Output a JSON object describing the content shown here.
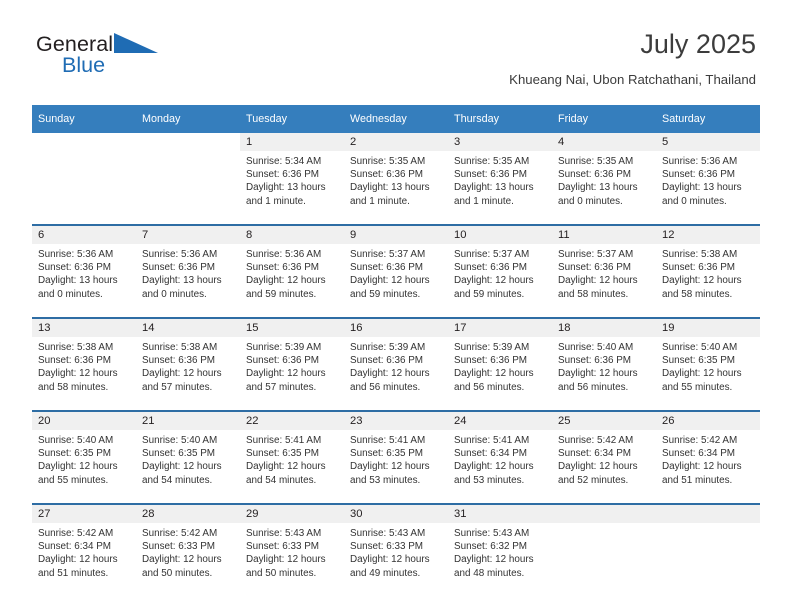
{
  "logo": {
    "line1": "General",
    "line2": "Blue",
    "triangle_color": "#1f6cb4",
    "text_color": "#231f20"
  },
  "header": {
    "title": "July 2025",
    "subtitle": "Khueang Nai, Ubon Ratchathani, Thailand"
  },
  "colors": {
    "header_row_bg": "#357ebd",
    "header_row_text": "#ffffff",
    "row_border": "#2e6da4",
    "daynum_bg": "#f0f0f0",
    "cell_text": "#333333"
  },
  "calendar": {
    "weekday_headers": [
      "Sunday",
      "Monday",
      "Tuesday",
      "Wednesday",
      "Thursday",
      "Friday",
      "Saturday"
    ],
    "weeks": [
      [
        {
          "day": "",
          "blank": true,
          "sunrise": "",
          "sunset": "",
          "daylight1": "",
          "daylight2": ""
        },
        {
          "day": "",
          "blank": true,
          "sunrise": "",
          "sunset": "",
          "daylight1": "",
          "daylight2": ""
        },
        {
          "day": "1",
          "sunrise": "Sunrise: 5:34 AM",
          "sunset": "Sunset: 6:36 PM",
          "daylight1": "Daylight: 13 hours",
          "daylight2": "and 1 minute."
        },
        {
          "day": "2",
          "sunrise": "Sunrise: 5:35 AM",
          "sunset": "Sunset: 6:36 PM",
          "daylight1": "Daylight: 13 hours",
          "daylight2": "and 1 minute."
        },
        {
          "day": "3",
          "sunrise": "Sunrise: 5:35 AM",
          "sunset": "Sunset: 6:36 PM",
          "daylight1": "Daylight: 13 hours",
          "daylight2": "and 1 minute."
        },
        {
          "day": "4",
          "sunrise": "Sunrise: 5:35 AM",
          "sunset": "Sunset: 6:36 PM",
          "daylight1": "Daylight: 13 hours",
          "daylight2": "and 0 minutes."
        },
        {
          "day": "5",
          "sunrise": "Sunrise: 5:36 AM",
          "sunset": "Sunset: 6:36 PM",
          "daylight1": "Daylight: 13 hours",
          "daylight2": "and 0 minutes."
        }
      ],
      [
        {
          "day": "6",
          "sunrise": "Sunrise: 5:36 AM",
          "sunset": "Sunset: 6:36 PM",
          "daylight1": "Daylight: 13 hours",
          "daylight2": "and 0 minutes."
        },
        {
          "day": "7",
          "sunrise": "Sunrise: 5:36 AM",
          "sunset": "Sunset: 6:36 PM",
          "daylight1": "Daylight: 13 hours",
          "daylight2": "and 0 minutes."
        },
        {
          "day": "8",
          "sunrise": "Sunrise: 5:36 AM",
          "sunset": "Sunset: 6:36 PM",
          "daylight1": "Daylight: 12 hours",
          "daylight2": "and 59 minutes."
        },
        {
          "day": "9",
          "sunrise": "Sunrise: 5:37 AM",
          "sunset": "Sunset: 6:36 PM",
          "daylight1": "Daylight: 12 hours",
          "daylight2": "and 59 minutes."
        },
        {
          "day": "10",
          "sunrise": "Sunrise: 5:37 AM",
          "sunset": "Sunset: 6:36 PM",
          "daylight1": "Daylight: 12 hours",
          "daylight2": "and 59 minutes."
        },
        {
          "day": "11",
          "sunrise": "Sunrise: 5:37 AM",
          "sunset": "Sunset: 6:36 PM",
          "daylight1": "Daylight: 12 hours",
          "daylight2": "and 58 minutes."
        },
        {
          "day": "12",
          "sunrise": "Sunrise: 5:38 AM",
          "sunset": "Sunset: 6:36 PM",
          "daylight1": "Daylight: 12 hours",
          "daylight2": "and 58 minutes."
        }
      ],
      [
        {
          "day": "13",
          "sunrise": "Sunrise: 5:38 AM",
          "sunset": "Sunset: 6:36 PM",
          "daylight1": "Daylight: 12 hours",
          "daylight2": "and 58 minutes."
        },
        {
          "day": "14",
          "sunrise": "Sunrise: 5:38 AM",
          "sunset": "Sunset: 6:36 PM",
          "daylight1": "Daylight: 12 hours",
          "daylight2": "and 57 minutes."
        },
        {
          "day": "15",
          "sunrise": "Sunrise: 5:39 AM",
          "sunset": "Sunset: 6:36 PM",
          "daylight1": "Daylight: 12 hours",
          "daylight2": "and 57 minutes."
        },
        {
          "day": "16",
          "sunrise": "Sunrise: 5:39 AM",
          "sunset": "Sunset: 6:36 PM",
          "daylight1": "Daylight: 12 hours",
          "daylight2": "and 56 minutes."
        },
        {
          "day": "17",
          "sunrise": "Sunrise: 5:39 AM",
          "sunset": "Sunset: 6:36 PM",
          "daylight1": "Daylight: 12 hours",
          "daylight2": "and 56 minutes."
        },
        {
          "day": "18",
          "sunrise": "Sunrise: 5:40 AM",
          "sunset": "Sunset: 6:36 PM",
          "daylight1": "Daylight: 12 hours",
          "daylight2": "and 56 minutes."
        },
        {
          "day": "19",
          "sunrise": "Sunrise: 5:40 AM",
          "sunset": "Sunset: 6:35 PM",
          "daylight1": "Daylight: 12 hours",
          "daylight2": "and 55 minutes."
        }
      ],
      [
        {
          "day": "20",
          "sunrise": "Sunrise: 5:40 AM",
          "sunset": "Sunset: 6:35 PM",
          "daylight1": "Daylight: 12 hours",
          "daylight2": "and 55 minutes."
        },
        {
          "day": "21",
          "sunrise": "Sunrise: 5:40 AM",
          "sunset": "Sunset: 6:35 PM",
          "daylight1": "Daylight: 12 hours",
          "daylight2": "and 54 minutes."
        },
        {
          "day": "22",
          "sunrise": "Sunrise: 5:41 AM",
          "sunset": "Sunset: 6:35 PM",
          "daylight1": "Daylight: 12 hours",
          "daylight2": "and 54 minutes."
        },
        {
          "day": "23",
          "sunrise": "Sunrise: 5:41 AM",
          "sunset": "Sunset: 6:35 PM",
          "daylight1": "Daylight: 12 hours",
          "daylight2": "and 53 minutes."
        },
        {
          "day": "24",
          "sunrise": "Sunrise: 5:41 AM",
          "sunset": "Sunset: 6:34 PM",
          "daylight1": "Daylight: 12 hours",
          "daylight2": "and 53 minutes."
        },
        {
          "day": "25",
          "sunrise": "Sunrise: 5:42 AM",
          "sunset": "Sunset: 6:34 PM",
          "daylight1": "Daylight: 12 hours",
          "daylight2": "and 52 minutes."
        },
        {
          "day": "26",
          "sunrise": "Sunrise: 5:42 AM",
          "sunset": "Sunset: 6:34 PM",
          "daylight1": "Daylight: 12 hours",
          "daylight2": "and 51 minutes."
        }
      ],
      [
        {
          "day": "27",
          "sunrise": "Sunrise: 5:42 AM",
          "sunset": "Sunset: 6:34 PM",
          "daylight1": "Daylight: 12 hours",
          "daylight2": "and 51 minutes."
        },
        {
          "day": "28",
          "sunrise": "Sunrise: 5:42 AM",
          "sunset": "Sunset: 6:33 PM",
          "daylight1": "Daylight: 12 hours",
          "daylight2": "and 50 minutes."
        },
        {
          "day": "29",
          "sunrise": "Sunrise: 5:43 AM",
          "sunset": "Sunset: 6:33 PM",
          "daylight1": "Daylight: 12 hours",
          "daylight2": "and 50 minutes."
        },
        {
          "day": "30",
          "sunrise": "Sunrise: 5:43 AM",
          "sunset": "Sunset: 6:33 PM",
          "daylight1": "Daylight: 12 hours",
          "daylight2": "and 49 minutes."
        },
        {
          "day": "31",
          "sunrise": "Sunrise: 5:43 AM",
          "sunset": "Sunset: 6:32 PM",
          "daylight1": "Daylight: 12 hours",
          "daylight2": "and 48 minutes."
        },
        {
          "day": "",
          "sunrise": "",
          "sunset": "",
          "daylight1": "",
          "daylight2": ""
        },
        {
          "day": "",
          "sunrise": "",
          "sunset": "",
          "daylight1": "",
          "daylight2": ""
        }
      ]
    ]
  }
}
